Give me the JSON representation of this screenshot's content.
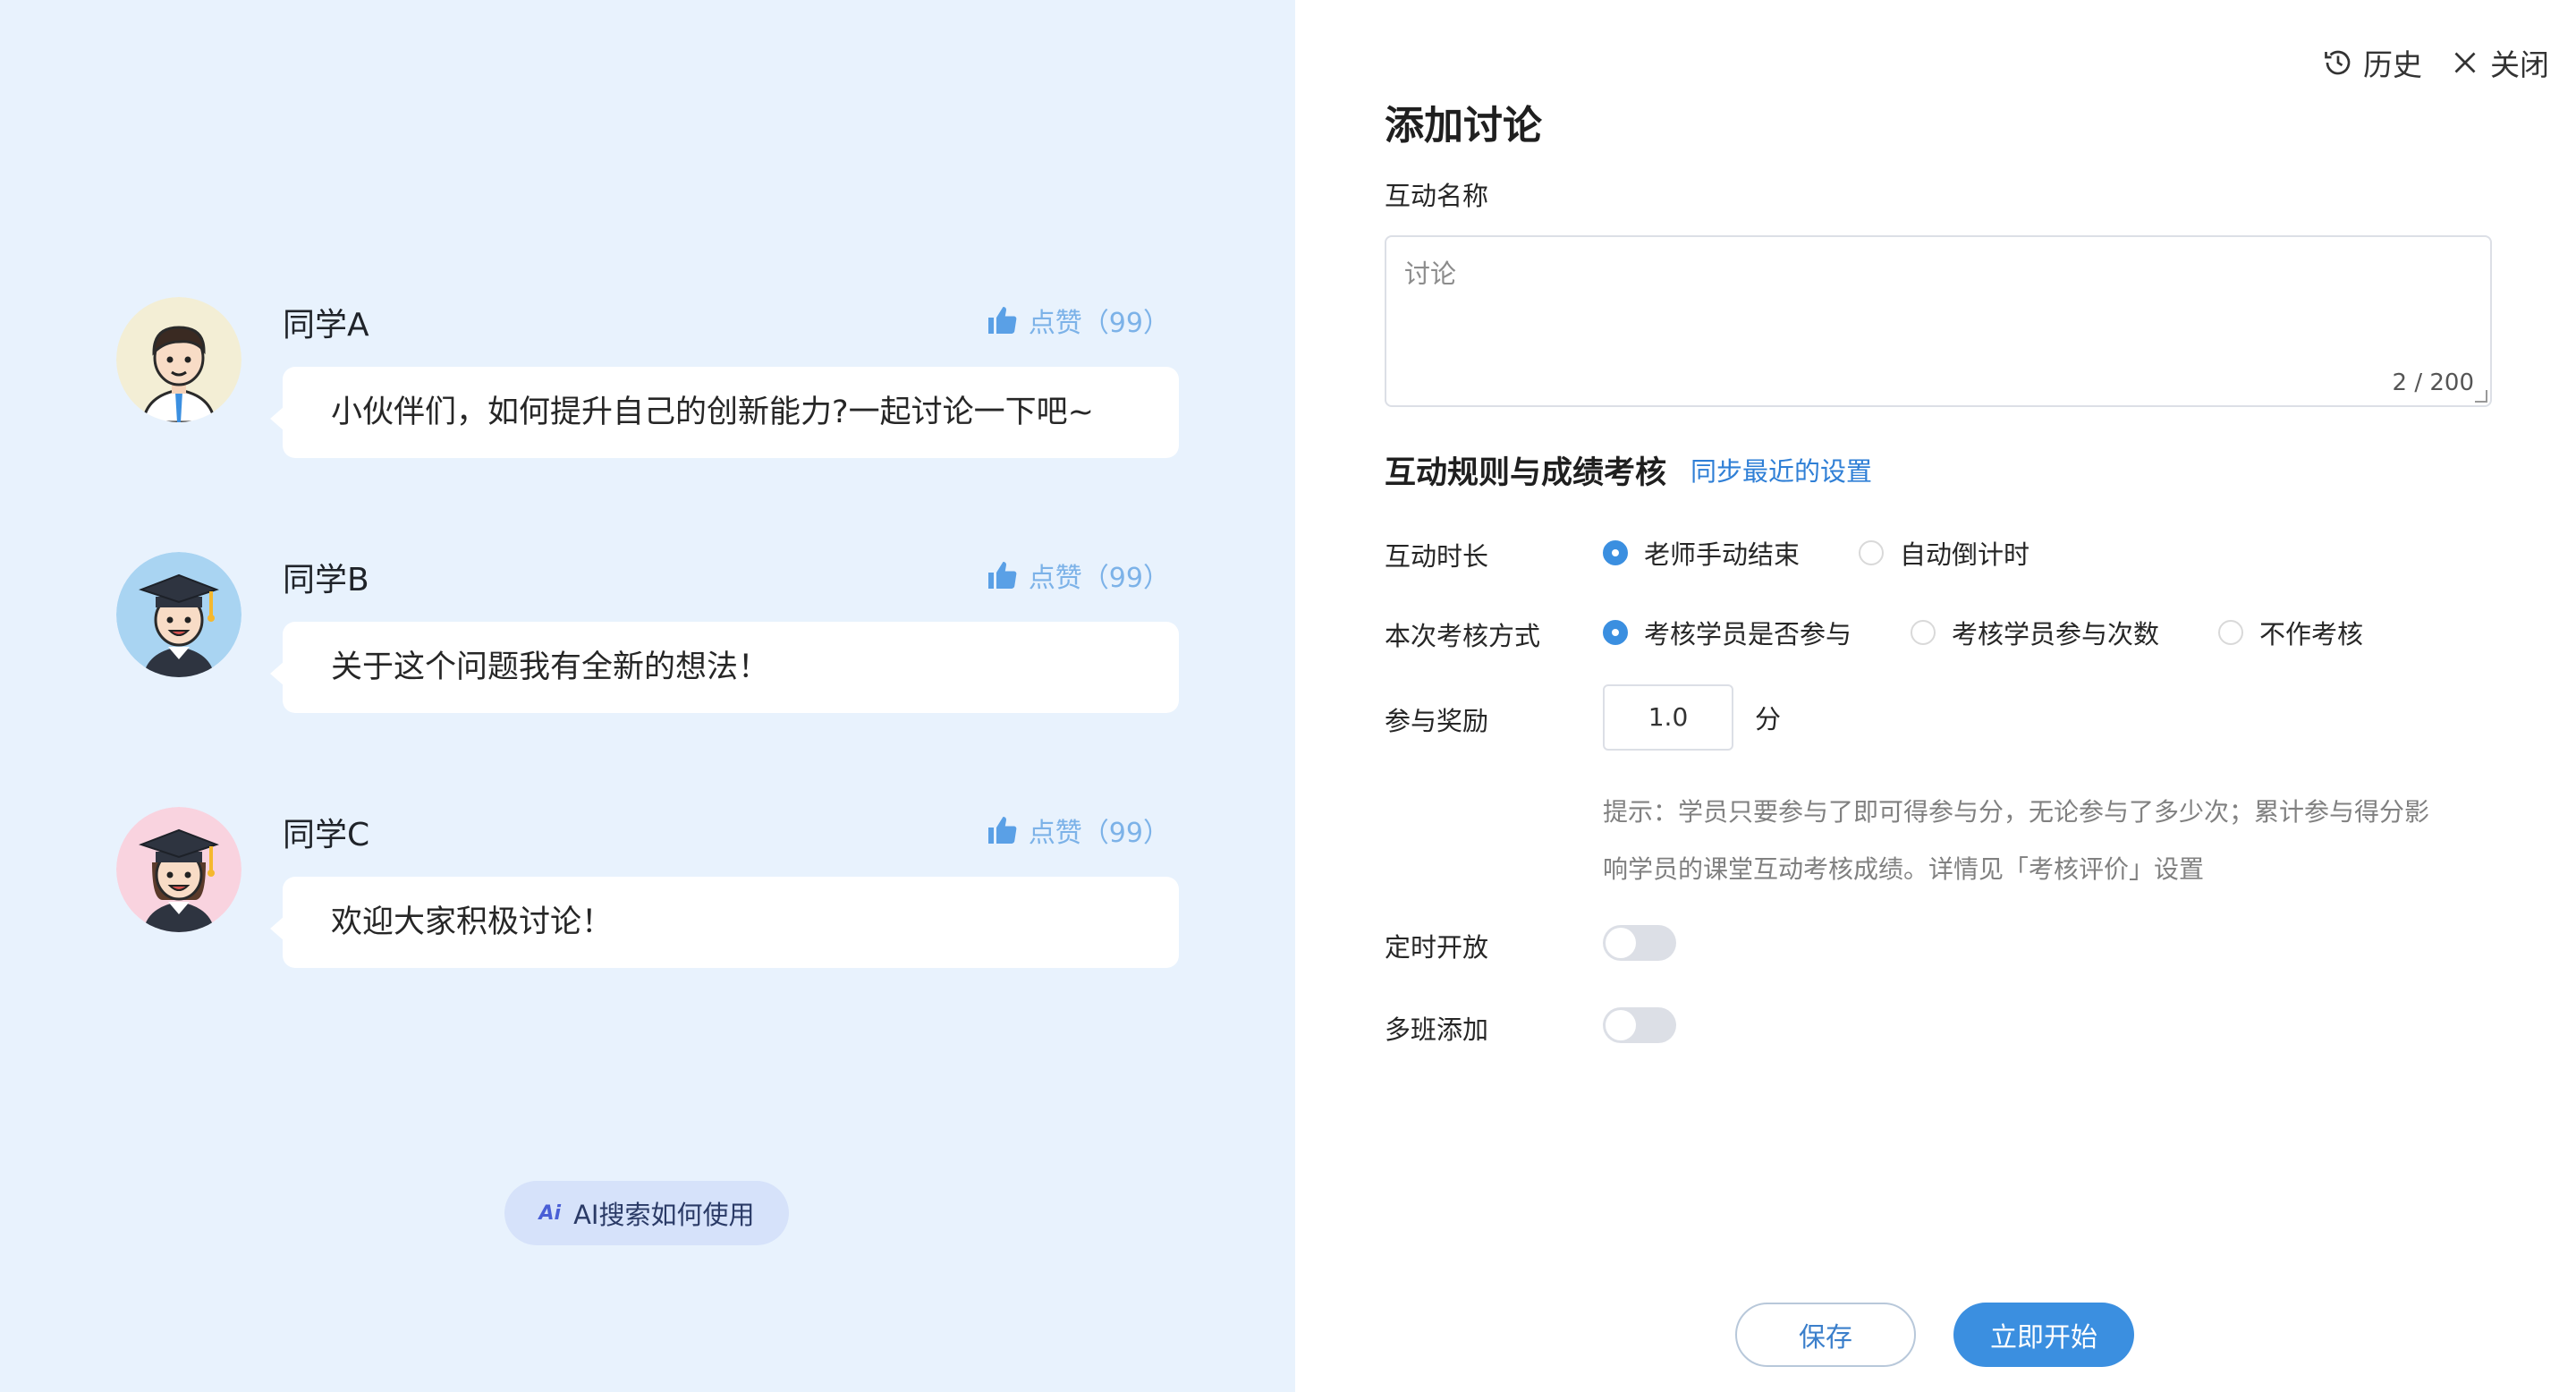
{
  "preview": {
    "messages": [
      {
        "name": "同学A",
        "like_label": "点赞",
        "like_count": "（99）",
        "text": "小伙伴们，如何提升自己的创新能力?一起讨论一下吧~"
      },
      {
        "name": "同学B",
        "like_label": "点赞",
        "like_count": "（99）",
        "text": "关于这个问题我有全新的想法！"
      },
      {
        "name": "同学C",
        "like_label": "点赞",
        "like_count": "（99）",
        "text": "欢迎大家积极讨论！"
      }
    ],
    "ai_mark": "Ai",
    "ai_button_label": "AI搜索如何使用"
  },
  "header": {
    "history_label": "历史",
    "close_label": "关闭"
  },
  "form": {
    "title": "添加讨论",
    "name_label": "互动名称",
    "name_placeholder": "讨论",
    "name_counter": "2 / 200",
    "rules_title": "互动规则与成绩考核",
    "sync_link": "同步最近的设置",
    "duration": {
      "label": "互动时长",
      "options": [
        "老师手动结束",
        "自动倒计时"
      ],
      "selected": "老师手动结束"
    },
    "assessment": {
      "label": "本次考核方式",
      "options": [
        "考核学员是否参与",
        "考核学员参与次数",
        "不作考核"
      ],
      "selected": "考核学员是否参与"
    },
    "reward": {
      "label": "参与奖励",
      "value": "1.0",
      "unit": "分"
    },
    "hint_line1": "提示：学员只要参与了即可得参与分，无论参与了多少次；累计参与得分影",
    "hint_line2": "响学员的课堂互动考核成绩。详情见「考核评价」设置",
    "scheduled_open": {
      "label": "定时开放",
      "on": false
    },
    "multi_class": {
      "label": "多班添加",
      "on": false
    },
    "save_label": "保存",
    "start_label": "立即开始"
  },
  "colors": {
    "accent": "#3b8fe0",
    "preview_bg": "#e8f2fd",
    "like": "#7cb2e8"
  },
  "icons": [
    "thumb-up-icon",
    "history-icon",
    "close-icon",
    "ai-icon"
  ]
}
